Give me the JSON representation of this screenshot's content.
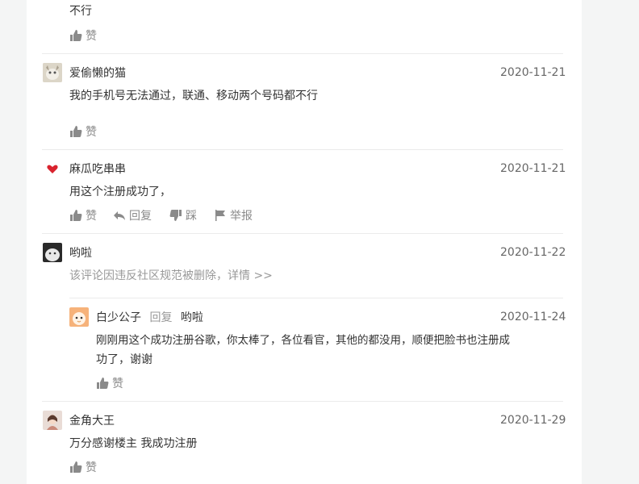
{
  "comments": [
    {
      "text": "不行",
      "like": "赞"
    },
    {
      "user": "爱偷懒的猫",
      "date": "2020-11-21",
      "text": "我的手机号无法通过，联通、移动两个号码都不行",
      "like": "赞"
    },
    {
      "user": "麻瓜吃串串",
      "date": "2020-11-21",
      "text": "用这个注册成功了，",
      "like": "赞",
      "reply": "回复",
      "dislike": "踩",
      "report": "举报"
    },
    {
      "user": "哟啦",
      "date": "2020-11-22",
      "deleted_text": "该评论因违反社区规范被删除，",
      "details_link": "详情 >>"
    },
    {
      "user": "白少公子",
      "reply_label": "回复",
      "reply_to": "哟啦",
      "date": "2020-11-24",
      "text_line1": "刚刚用这个成功注册谷歌，你太棒了，各位看官，其他的都没用，顺便把脸书也注册成",
      "text_line2": "功了，谢谢",
      "like": "赞"
    },
    {
      "user": "金角大王",
      "date": "2020-11-29",
      "text": "万分感谢楼主 我成功注册",
      "like": "赞"
    }
  ]
}
